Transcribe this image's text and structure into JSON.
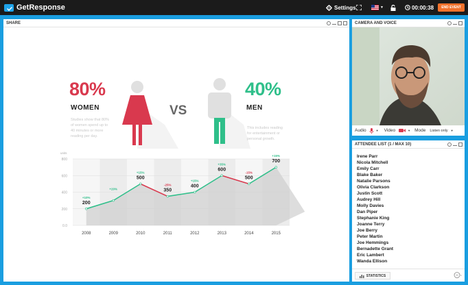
{
  "topbar": {
    "brand": "GetResponse",
    "settings_label": "Settings",
    "timer": "00:00:38",
    "end_event_label": "END EVENT"
  },
  "share": {
    "title": "SHARE",
    "women": {
      "percent": "80%",
      "label": "WOMEN",
      "note": [
        "Studies show that 80%",
        "of women spend up to",
        "40 minutes or more",
        "reading per day."
      ]
    },
    "vs": "VS",
    "men": {
      "percent": "40%",
      "label": "MEN",
      "note": [
        "This includes reading",
        "for entertainment or",
        "personal growth."
      ]
    },
    "colors": {
      "women": "#d9394e",
      "men": "#2fbf8a",
      "grey": "#e0e0e0"
    }
  },
  "chart_data": {
    "type": "line",
    "ylabel": "units",
    "yticks": [
      "800",
      "600",
      "400",
      "200",
      "0.0"
    ],
    "ylim": [
      0,
      800
    ],
    "categories": [
      "2008",
      "2009",
      "2010",
      "2011",
      "2012",
      "2013",
      "2014",
      "2015"
    ],
    "series": [
      {
        "values": [
          200,
          300,
          500,
          350,
          400,
          600,
          500,
          700
        ],
        "changes": [
          "+10%",
          "+20%",
          "+15%",
          "-25%",
          "+15%",
          "+35%",
          "-15%",
          "+15%"
        ],
        "labels": [
          "200",
          "",
          "500",
          "350",
          "400",
          "600",
          "500",
          "700"
        ]
      }
    ]
  },
  "camera": {
    "title": "CAMERA AND VOICE",
    "audio_label": "Audio",
    "video_label": "Video",
    "mode_label": "Mode",
    "mode_value": "Listen only"
  },
  "attendees": {
    "title": "ATTENDEE LIST  (1 / MAX 10)",
    "names": [
      "Irene Parr",
      "Nicola Mitchell",
      "Emily Carr",
      "Blake Baker",
      "Natalie Parsons",
      "Olivia Clarkson",
      "Justin Scott",
      "Audrey Hill",
      "Molly Davies",
      "Dan Piper",
      "Stephanie King",
      "Joanne Terry",
      "Joe Berry",
      "Peter Martin",
      "Joe Hemmings",
      "Bernadette Grant",
      "Eric Lambert",
      "Wanda Ellison"
    ],
    "statistics_label": "STATISTICS"
  }
}
